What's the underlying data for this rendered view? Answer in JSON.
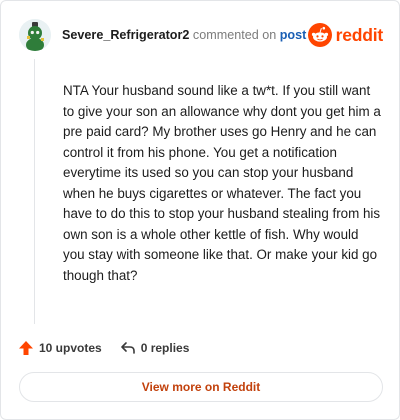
{
  "comment": {
    "username": "Severe_Refrigerator2",
    "meta_text": "commented on",
    "post_link_label": "post",
    "body": "NTA Your husband sound like a tw*t. If you still want to give your son an allowance why dont you get him a pre paid card? My brother uses go Henry and he can control it from his phone. You get a notification everytime its used so you can stop your husband when he buys cigarettes or whatever. The fact you have to do this to stop your husband stealing from his own son is a whole other kettle of fish. Why would you stay with someone like that. Or make your kid go though that?"
  },
  "brand": {
    "word": "reddit",
    "color": "#ff4500",
    "icon": "reddit-snoo-icon"
  },
  "actions": {
    "upvotes_label": "10 upvotes",
    "replies_label": "0 replies",
    "upvote_icon": "upvote-arrow-icon",
    "reply_icon": "reply-arrow-icon",
    "upvote_color": "#ff4500"
  },
  "footer": {
    "view_more_label": "View more on Reddit"
  }
}
